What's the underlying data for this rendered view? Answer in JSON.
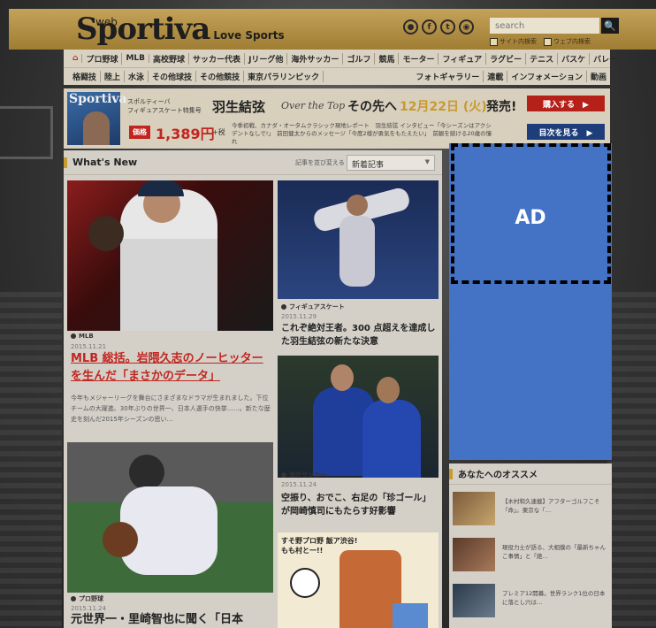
{
  "header": {
    "logo_web": "web",
    "logo_main": "Sportiva",
    "logo_tag": "Love Sports",
    "social_icons": [
      "user-icon",
      "facebook-icon",
      "twitter-icon",
      "rss-icon"
    ],
    "search_placeholder": "search",
    "search_button": "🔍",
    "scope_site": "サイト内検索",
    "scope_web": "ウェブ内検索"
  },
  "nav": {
    "row1": [
      "プロ野球",
      "MLB",
      "高校野球",
      "サッカー代表",
      "Jリーグ他",
      "海外サッカー",
      "ゴルフ",
      "競馬",
      "モーター",
      "フィギュア",
      "ラグビー",
      "テニス",
      "バスケ",
      "バレー"
    ],
    "row2": [
      "格闘技",
      "陸上",
      "水泳",
      "その他球技",
      "その他競技",
      "東京パラリンピック"
    ],
    "row2_right": [
      "フォトギャラリー",
      "連載",
      "インフォメーション",
      "動画"
    ]
  },
  "banner": {
    "mag_title": "Sportiva",
    "small_line1": "スポルティーバ",
    "small_line2": "フィギュアスケート特集号",
    "name": "羽生結弦",
    "over_the_top": "Over the Top",
    "next": "その先へ",
    "date": "12月22日 (火)",
    "release": "発売!",
    "price_label": "価格",
    "price": "1,389円",
    "tax": "+税",
    "desc": "今季初戦、カナダ・オータムクラシック現地レポート　羽生結弦 インタビュー「今シーズンはアクシデントなしで!」　前田健太からのメッセージ「今度2様が勇気をもたえたい」　前観を続ける20歳の憧れ",
    "buy_button": "購入する　▶",
    "toc_button": "目次を見る　▶"
  },
  "whats_new": {
    "title": "What's New",
    "sort_label": "記事を並び変える",
    "sort_value": "新着記事",
    "cards": [
      {
        "category": "MLB",
        "date": "2015.11.21",
        "title": "MLB 総括。岩隈久志のノーヒッターを生んだ「まさかのデータ」",
        "text": "今年もメジャーリーグを舞台にさまざまなドラマが生まれました。下位チームの大躍進、30年ぶりの世界一、日本人選手の快挙……。新たな歴史を刻んだ2015年シーズンの思い…"
      },
      {
        "category": "フィギュアスケート",
        "date": "2015.11.29",
        "title": "これぞ絶対王者。300 点超えを達成した羽生結弦の新たな決意"
      },
      {
        "category": "海外サッカー",
        "date": "2015.11.24",
        "title": "空振り、おでこ、右足の「珍ゴール」が岡崎慎司にもたらす好影響"
      },
      {
        "category": "プロ野球",
        "date": "2015.11.24",
        "title": "元世界一・里崎智也に聞く「日本"
      }
    ],
    "comic_text": "すそ野プロ野 飯ア渋谷!\nもも村と一!!"
  },
  "ad": {
    "label": "AD"
  },
  "recommend": {
    "title": "あなたへのオススメ",
    "items": [
      "【木村和久連載】アフターゴルフこそ「命」。東京な「…",
      "現役力士が語る、大相撲の「最新ちゃんこ事情」と「絶…",
      "プレミア12開幕。世界ランク1位の日本に落とし穴は…"
    ]
  }
}
